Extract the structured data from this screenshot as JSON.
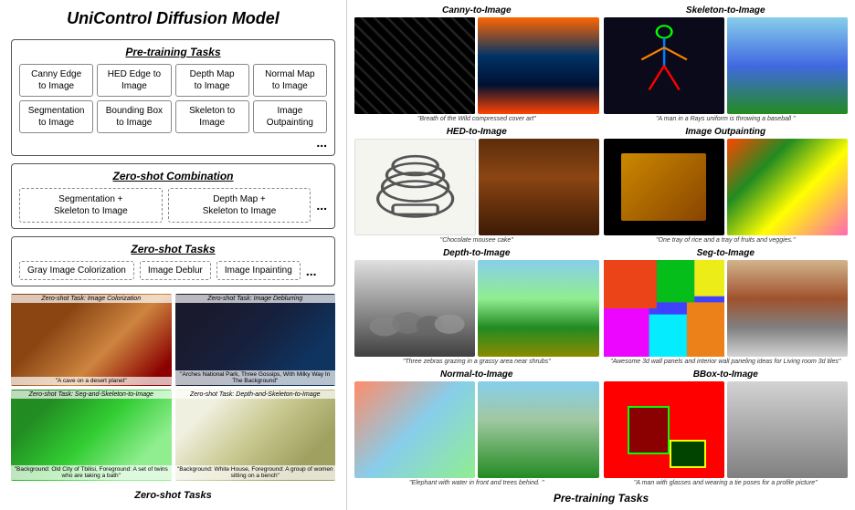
{
  "left": {
    "main_title": "UniControl Diffusion Model",
    "pretraining": {
      "section_title": "Pre-training Tasks",
      "tasks": [
        {
          "label": "Canny Edge\nto Image"
        },
        {
          "label": "HED Edge to\nImage"
        },
        {
          "label": "Depth Map\nto Image"
        },
        {
          "label": "Normal Map\nto Image"
        },
        {
          "label": "Segmentation\nto Image"
        },
        {
          "label": "Bounding Box\nto Image"
        },
        {
          "label": "Skeleton to\nImage"
        },
        {
          "label": "Image\nOutpainting"
        }
      ],
      "dots": "..."
    },
    "zeroshot_combo": {
      "section_title": "Zero-shot Combination",
      "combos": [
        {
          "label": "Segmentation +\nSkeleton to Image"
        },
        {
          "label": "Depth Map +\nSkeleton to Image"
        }
      ],
      "dots": "..."
    },
    "zeroshot_tasks": {
      "section_title": "Zero-shot Tasks",
      "tasks": [
        "Gray Image Colorization",
        "Image Deblur",
        "Image Inpainting"
      ],
      "dots": "..."
    },
    "screenshots": [
      {
        "top_label": "Zero-shot Task: Image Colorization",
        "bottom_label": "\"A cave on a desert planet\""
      },
      {
        "top_label": "Zero-shot Task: Image Deblurring",
        "bottom_label": "\"Arches National Park, Three Gossips, With Milky Way In The Background\""
      },
      {
        "top_label": "Zero-shot Task: Seg-and-Skeleton-to-Image",
        "bottom_label": "\"Background: Old City of Tbilisi, Foreground: A set of twins who are taking a bath\""
      },
      {
        "top_label": "Zero-shot Task: Depth-and-Skeleton-to-Image",
        "bottom_label": "\"Background: White House, Foreground: A group of women sitting on a bench\""
      }
    ],
    "bottom_label": "Zero-shot Tasks"
  },
  "right": {
    "sections": [
      {
        "id": "canny",
        "title": "Canny-to-Image",
        "caption": "\"Breath of the Wild compressed cover art\""
      },
      {
        "id": "skeleton",
        "title": "Skeleton-to-Image",
        "caption": "\"A man in a Rays uniform is throwing a baseball \""
      },
      {
        "id": "hed",
        "title": "HED-to-Image",
        "caption": "\"Chocolate mousee cake\""
      },
      {
        "id": "outpainting",
        "title": "Image Outpainting",
        "caption": "\"One tray of rice and a tray of fruits and veggies.\""
      },
      {
        "id": "depth",
        "title": "Depth-to-Image",
        "caption": "\"Three zebras grazing in a grassy area near shrubs\""
      },
      {
        "id": "seg",
        "title": "Seg-to-Image",
        "caption": "\"Awesome 3d wall panels and interior wall paneling ideas for Living room 3d tiles\""
      },
      {
        "id": "normal",
        "title": "Normal-to-Image",
        "caption": "\"Elephant with water in front and trees behind. \""
      },
      {
        "id": "bbox",
        "title": "BBox-to-Image",
        "caption": "\"A man with glasses and wearing a tie poses for a profile picture\""
      }
    ],
    "bottom_label": "Pre-training Tasks"
  }
}
